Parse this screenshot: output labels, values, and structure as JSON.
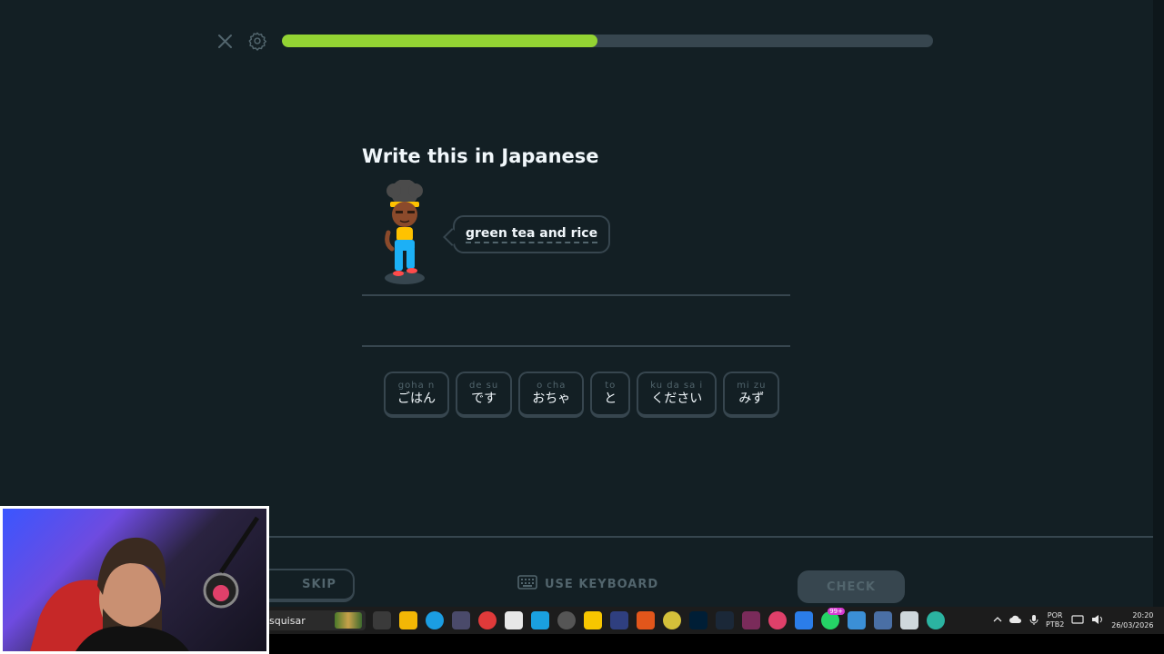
{
  "progress": {
    "value": 0.485
  },
  "prompt": {
    "title": "Write this in Japanese",
    "sentence": "green tea and rice"
  },
  "word_bank": [
    {
      "romaji": "goha n",
      "kana": "ごはん"
    },
    {
      "romaji": "de su",
      "kana": "です"
    },
    {
      "romaji": "o  cha",
      "kana": "おちゃ"
    },
    {
      "romaji": "to",
      "kana": "と"
    },
    {
      "romaji": "ku da sa  i",
      "kana": "ください"
    },
    {
      "romaji": "mi zu",
      "kana": "みず"
    }
  ],
  "footer": {
    "skip": "SKIP",
    "keyboard": "USE KEYBOARD",
    "check": "CHECK"
  },
  "taskbar": {
    "search_text": "squisar",
    "notification_badge": "99+",
    "language": {
      "line1": "POR",
      "line2": "PTB2"
    },
    "time": "20:20",
    "date": "26/03/2026"
  },
  "colors": {
    "background": "#131f24",
    "progress_fill": "#93d333",
    "border": "#37464f",
    "muted_text": "#52656d"
  },
  "icons": [
    "close-icon",
    "gear-icon",
    "keyboard-icon"
  ]
}
